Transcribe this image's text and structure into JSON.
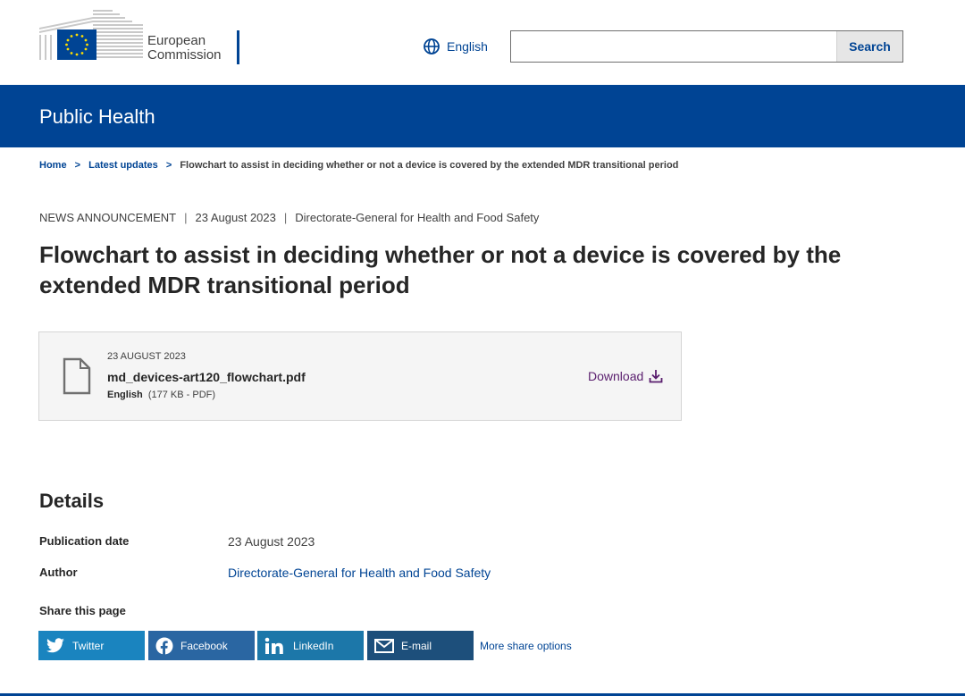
{
  "header": {
    "logo_line1": "European",
    "logo_line2": "Commission",
    "language": "English",
    "search_value": "",
    "search_button": "Search"
  },
  "site": {
    "name": "Public Health"
  },
  "breadcrumb": {
    "items": [
      "Home",
      "Latest updates"
    ],
    "current": "Flowchart to assist in deciding whether or not a device is covered by the extended MDR transitional period",
    "separator": ">"
  },
  "meta": {
    "type": "NEWS ANNOUNCEMENT",
    "date": "23 August 2023",
    "author": "Directorate-General for Health and Food Safety"
  },
  "page": {
    "title": "Flowchart to assist in deciding whether or not a device is covered by the extended MDR transitional period"
  },
  "file": {
    "date": "23 AUGUST 2023",
    "name": "md_devices-art120_flowchart.pdf",
    "language": "English",
    "info": "(177 KB - PDF)",
    "download_label": "Download"
  },
  "details": {
    "title": "Details",
    "publication_date_label": "Publication date",
    "publication_date_value": "23 August 2023",
    "author_label": "Author",
    "author_value": "Directorate-General for Health and Food Safety"
  },
  "share": {
    "title": "Share this page",
    "buttons": [
      "Twitter",
      "Facebook",
      "LinkedIn",
      "E-mail"
    ],
    "more": "More share options"
  },
  "colors": {
    "primary": "#004494",
    "download": "#5a1e6e",
    "twitter": "#1a84bf",
    "facebook": "#2a66a2",
    "linkedin": "#1c77a9",
    "email": "#1d4f7b"
  }
}
